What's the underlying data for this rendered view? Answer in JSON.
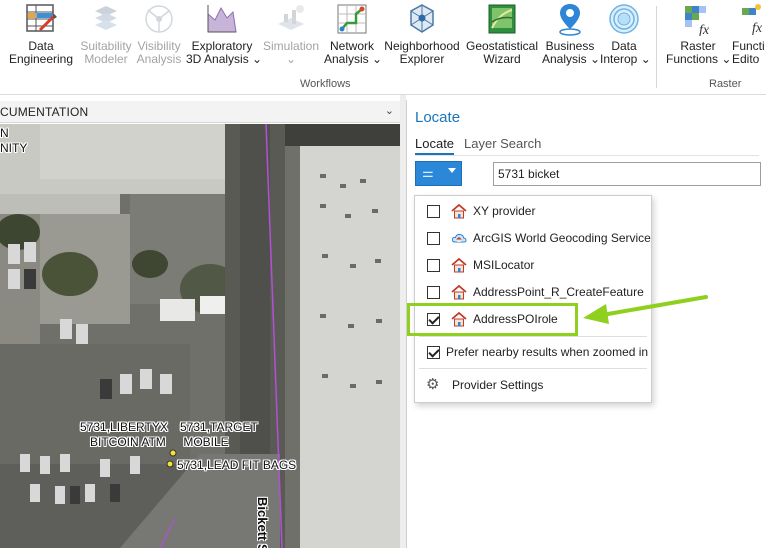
{
  "ribbon": {
    "tools": [
      {
        "id": "data-engineering",
        "label": "Data\nEngineering",
        "enabled": true
      },
      {
        "id": "suitability-modeler",
        "label": "Suitability\nModeler",
        "enabled": false
      },
      {
        "id": "visibility-analysis",
        "label": "Visibility\nAnalysis",
        "enabled": false
      },
      {
        "id": "exploratory-3d",
        "label": "Exploratory\n3D Analysis ⌄",
        "enabled": true
      },
      {
        "id": "simulation",
        "label": "Simulation\n⌄",
        "enabled": false
      },
      {
        "id": "network-analysis",
        "label": "Network\nAnalysis ⌄",
        "enabled": true
      },
      {
        "id": "neighborhood-explorer",
        "label": "Neighborhood\nExplorer",
        "enabled": true
      },
      {
        "id": "geostatistical-wizard",
        "label": "Geostatistical\nWizard",
        "enabled": true
      },
      {
        "id": "business-analysis",
        "label": "Business\nAnalysis ⌄",
        "enabled": true
      },
      {
        "id": "data-interop",
        "label": "Data\nInterop ⌄",
        "enabled": true
      },
      {
        "id": "raster-functions",
        "label": "Raster\nFunctions ⌄",
        "enabled": true
      },
      {
        "id": "function-editor",
        "label": "Functi\nEdito",
        "enabled": true
      }
    ],
    "groups": {
      "workflows": "Workflows",
      "raster": "Raster"
    }
  },
  "map": {
    "view_title": "CUMENTATION",
    "corner_text": "N\nNITY",
    "labels": {
      "poi1": "5731,LIBERTYX\n   BITCOIN ATM",
      "poi2": "5731,TARGET\n MOBILE",
      "poi3": "5731,LEAD FIT BAGS",
      "street": "Bickett St"
    }
  },
  "locate": {
    "title": "Locate",
    "tabs": {
      "locate": "Locate",
      "layer_search": "Layer Search"
    },
    "search_value": "5731 bicket",
    "providers": [
      {
        "label": "XY provider",
        "checked": false,
        "icon": "house-locator-icon"
      },
      {
        "label": "ArcGIS World Geocoding Service",
        "checked": false,
        "icon": "cloud-locator-icon"
      },
      {
        "label": "MSILocator",
        "checked": false,
        "icon": "house-locator-icon"
      },
      {
        "label": "AddressPoint_R_CreateFeature",
        "checked": false,
        "icon": "house-locator-icon"
      },
      {
        "label": "AddressPOIrole",
        "checked": true,
        "icon": "house-locator-icon"
      }
    ],
    "prefer_nearby": {
      "label": "Prefer nearby results when zoomed in",
      "checked": true
    },
    "provider_settings": "Provider Settings"
  },
  "colors": {
    "accent": "#1b75bc",
    "highlight": "#8fd01f",
    "filter_button": "#2b88d8"
  }
}
